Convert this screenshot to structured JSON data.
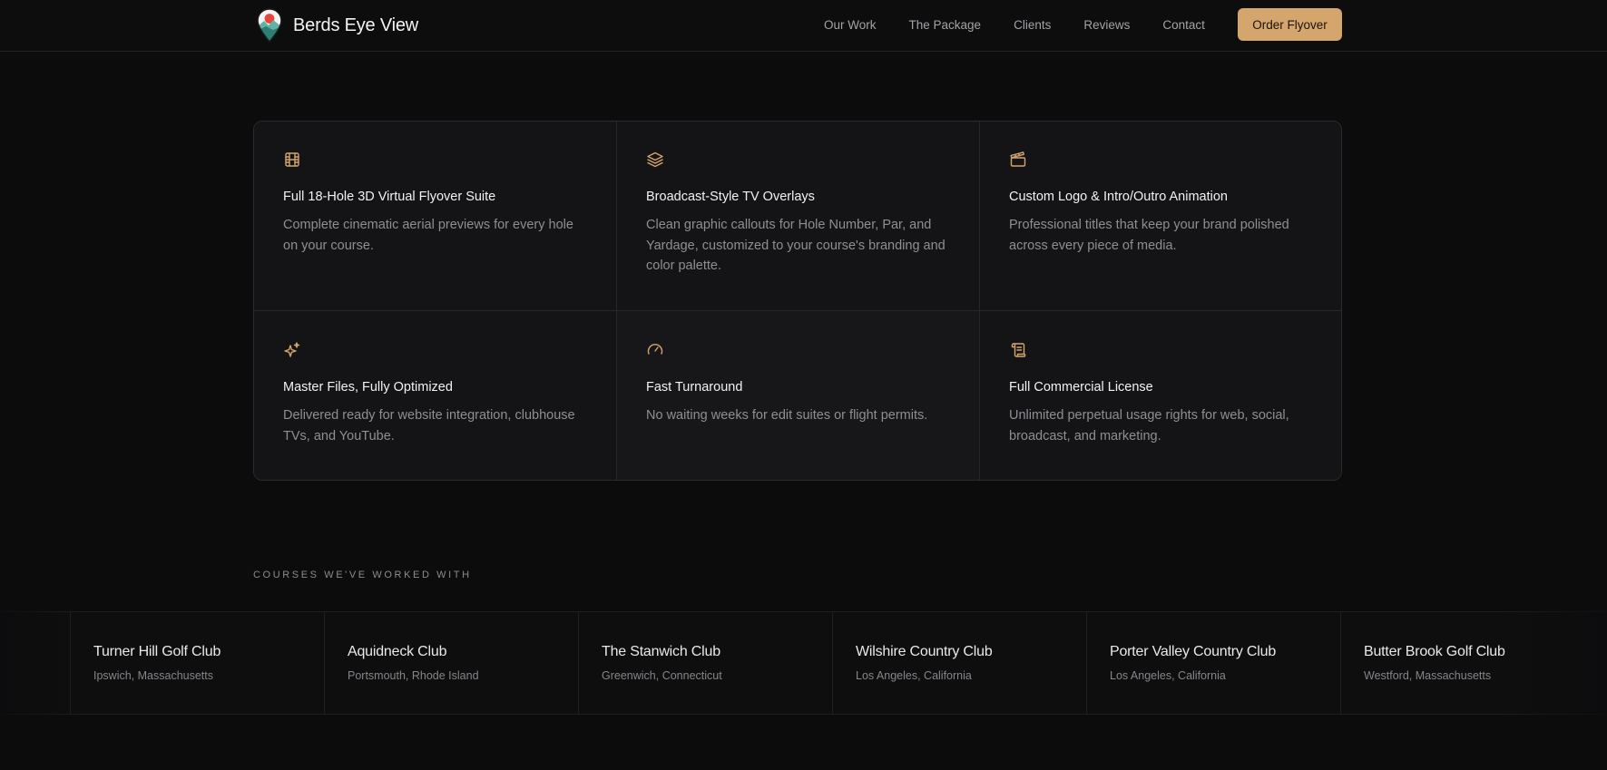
{
  "brand": {
    "name": "Berds Eye View"
  },
  "nav": {
    "items": [
      {
        "label": "Our Work"
      },
      {
        "label": "The Package"
      },
      {
        "label": "Clients"
      },
      {
        "label": "Reviews"
      },
      {
        "label": "Contact"
      }
    ],
    "cta_label": "Order Flyover"
  },
  "colors": {
    "accent": "#d4a56d",
    "background": "#0c0c0d",
    "card_background": "#141416"
  },
  "features": [
    {
      "icon": "film-icon",
      "title": "Full 18-Hole 3D Virtual Flyover Suite",
      "description": "Complete cinematic aerial previews for every hole on your course."
    },
    {
      "icon": "layers-icon",
      "title": "Broadcast-Style TV Overlays",
      "description": "Clean graphic callouts for Hole Number, Par, and Yardage, customized to your course's branding and color palette."
    },
    {
      "icon": "clapperboard-icon",
      "title": "Custom Logo & Intro/Outro Animation",
      "description": "Professional titles that keep your brand polished across every piece of media."
    },
    {
      "icon": "sparkles-icon",
      "title": "Master Files, Fully Optimized",
      "description": "Delivered ready for website integration, clubhouse TVs, and YouTube."
    },
    {
      "icon": "gauge-icon",
      "title": "Fast Turnaround",
      "description": "No waiting weeks for edit suites or flight permits."
    },
    {
      "icon": "scroll-icon",
      "title": "Full Commercial License",
      "description": "Unlimited perpetual usage rights for web, social, broadcast, and marketing."
    }
  ],
  "courses": {
    "label": "COURSES WE'VE WORKED WITH",
    "items": [
      {
        "name": "Turner Hill Golf Club",
        "location": "Ipswich, Massachusetts"
      },
      {
        "name": "Aquidneck Club",
        "location": "Portsmouth, Rhode Island"
      },
      {
        "name": "The Stanwich Club",
        "location": "Greenwich, Connecticut"
      },
      {
        "name": "Wilshire Country Club",
        "location": "Los Angeles, California"
      },
      {
        "name": "Porter Valley Country Club",
        "location": "Los Angeles, California"
      },
      {
        "name": "Butter Brook Golf Club",
        "location": "Westford, Massachusetts"
      }
    ]
  }
}
